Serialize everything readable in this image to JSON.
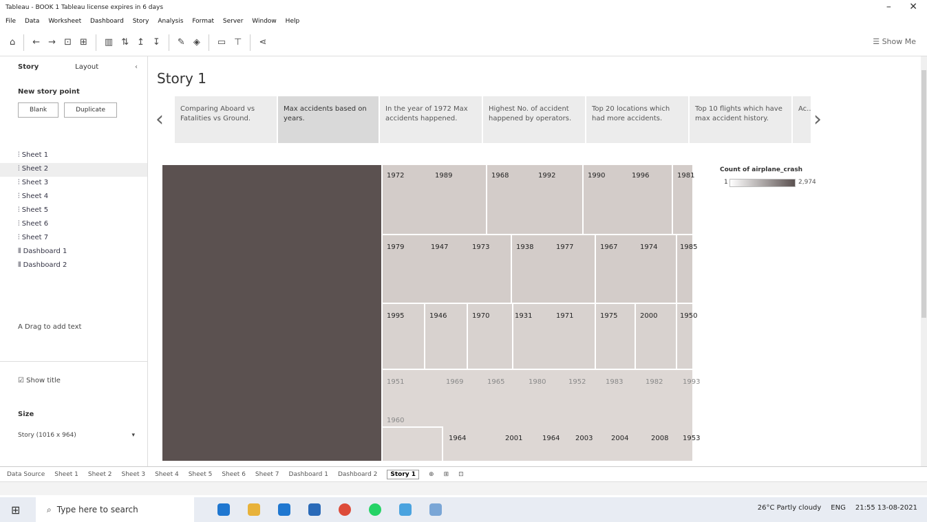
{
  "window": {
    "title": "Tableau - BOOK 1  Tableau license expires in 6 days"
  },
  "menu": [
    "File",
    "Data",
    "Worksheet",
    "Dashboard",
    "Story",
    "Analysis",
    "Format",
    "Server",
    "Window",
    "Help"
  ],
  "toolbar": {
    "show_me": "Show Me"
  },
  "pane": {
    "tab_story": "Story",
    "tab_layout": "Layout",
    "new_story_point": "New story point",
    "blank": "Blank",
    "duplicate": "Duplicate",
    "sheets": [
      "Sheet 1",
      "Sheet 2",
      "Sheet 3",
      "Sheet 4",
      "Sheet 5",
      "Sheet 6",
      "Sheet 7",
      "Dashboard 1",
      "Dashboard 2"
    ],
    "drag_text": "Drag to add text",
    "show_title": "Show title",
    "size_label": "Size",
    "size_value": "Story (1016 x 964)"
  },
  "story": {
    "title": "Story 1",
    "points": [
      "Comparing Aboard vs Fatalities vs Ground.",
      "Max accidents based on years.",
      "In the year of 1972 Max accidents happened.",
      "Highest No. of accident happened by operators.",
      "Top 20 locations which had more accidents.",
      "Top 10 flights which have max accident history.",
      "Ac..."
    ]
  },
  "legend": {
    "title": "Count of airplane_crash",
    "min": "1",
    "max": "2,974"
  },
  "treemap_rows": [
    [
      "1972",
      "1989",
      "1968",
      "1992",
      "1990",
      "1996",
      "1981"
    ],
    [
      "1979",
      "1947",
      "1973",
      "1938",
      "1977",
      "1967",
      "1974",
      "1985"
    ],
    [
      "1995",
      "1946",
      "1970",
      "1931",
      "1971",
      "1975",
      "2000",
      "1950"
    ],
    [
      "1951",
      "1969",
      "1965",
      "1980",
      "1952",
      "1983",
      "1982",
      "1993"
    ],
    [
      "1960",
      "1964",
      "2001",
      "1964",
      "2003",
      "2004",
      "2008",
      "1953"
    ]
  ],
  "sheet_tabs": [
    "Data Source",
    "Sheet 1",
    "Sheet 2",
    "Sheet 3",
    "Sheet 4",
    "Sheet 5",
    "Sheet 6",
    "Sheet 7",
    "Dashboard 1",
    "Dashboard 2",
    "Story 1"
  ],
  "taskbar": {
    "search_placeholder": "Type here to search",
    "weather": "26°C  Partly cloudy",
    "lang": "ENG",
    "time": "21:55",
    "date": "13-08-2021"
  },
  "colors": {
    "dark_block": "#5b5150",
    "cell": "#d3ccc9",
    "cell_light": "#ddd7d4",
    "accent": "#1f77d0"
  }
}
